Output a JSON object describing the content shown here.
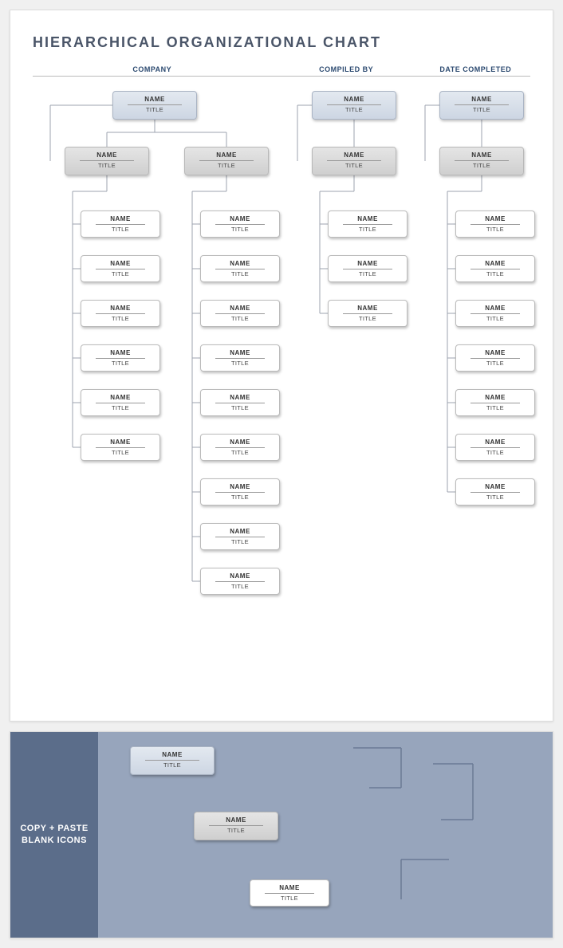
{
  "title": "HIERARCHICAL ORGANIZATIONAL CHART",
  "headers": {
    "company": "COMPANY",
    "compiledBy": "COMPILED BY",
    "dateCompleted": "DATE COMPLETED"
  },
  "box": {
    "name": "NAME",
    "title": "TITLE",
    "sep": "––––––––"
  },
  "palette": {
    "side": "COPY + PASTE BLANK ICONS"
  },
  "chart_data": {
    "type": "org",
    "columns": [
      {
        "id": "A",
        "top": {
          "name": "NAME",
          "title": "TITLE"
        },
        "hasMid": true,
        "children": 6,
        "sharesTopWith": "B"
      },
      {
        "id": "B",
        "hasMid": true,
        "children": 9
      },
      {
        "id": "C",
        "top": {
          "name": "NAME",
          "title": "TITLE"
        },
        "hasMid": true,
        "children": 3
      },
      {
        "id": "D",
        "top": {
          "name": "NAME",
          "title": "TITLE"
        },
        "hasMid": true,
        "children": 7
      }
    ]
  }
}
